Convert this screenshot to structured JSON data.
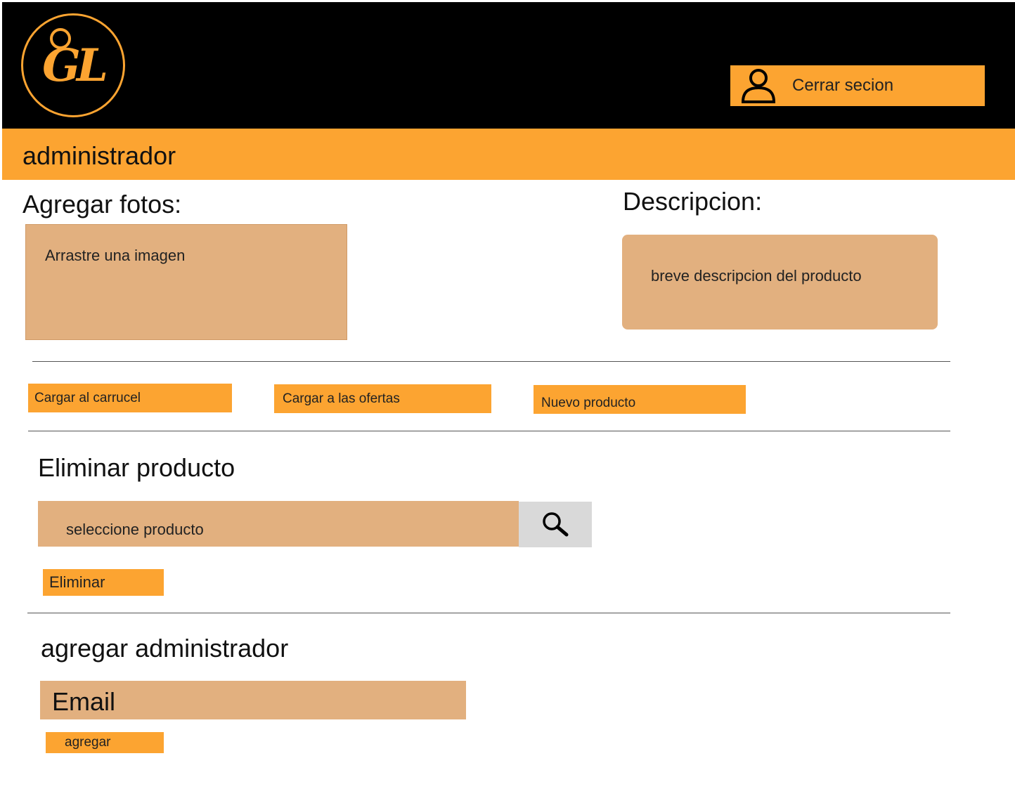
{
  "brand": {
    "logo_text": "GL"
  },
  "header": {
    "logout_label": "Cerrar secion",
    "logout_icon": "user-icon"
  },
  "bar": {
    "title": "administrador"
  },
  "photos": {
    "heading": "Agregar fotos:",
    "dropzone_hint": "Arrastre una imagen"
  },
  "description": {
    "heading": "Descripcion:",
    "placeholder": "breve descripcion del producto"
  },
  "actions": {
    "carousel_label": "Cargar al carrucel",
    "offers_label": "Cargar a las ofertas",
    "new_product_label": "Nuevo producto"
  },
  "delete_section": {
    "heading": "Eliminar producto",
    "select_placeholder": "seleccione producto",
    "search_icon": "search-icon",
    "delete_label": "Eliminar"
  },
  "admin_section": {
    "heading": "agregar  administrador",
    "email_placeholder": "Email",
    "add_label": "agregar"
  },
  "colors": {
    "black": "#000000",
    "orange": "#fca431",
    "tan": "#e2b07f",
    "gray": "#d9d9d9"
  }
}
